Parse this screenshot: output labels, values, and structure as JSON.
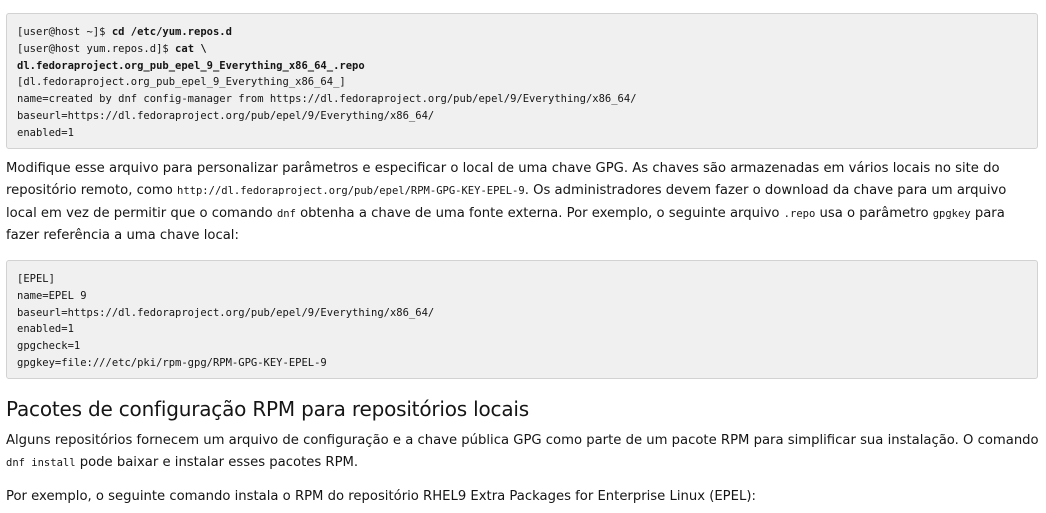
{
  "code_block_1": {
    "lines": [
      {
        "prompt": "[user@host ~]$ ",
        "command": "cd /etc/yum.repos.d"
      },
      {
        "prompt": "[user@host yum.repos.d]$ ",
        "command": "cat \\"
      },
      {
        "prompt": "",
        "command": "dl.fedoraproject.org_pub_epel_9_Everything_x86_64_.repo"
      },
      {
        "output": "[dl.fedoraproject.org_pub_epel_9_Everything_x86_64_]"
      },
      {
        "output": "name=created by dnf config-manager from https://dl.fedoraproject.org/pub/epel/9/Everything/x86_64/"
      },
      {
        "output": "baseurl=https://dl.fedoraproject.org/pub/epel/9/Everything/x86_64/"
      },
      {
        "output": "enabled=1"
      }
    ]
  },
  "paragraph_1": {
    "text_1": "Modifique esse arquivo para personalizar parâmetros e especificar o local de uma chave GPG. As chaves são armazenadas em vários locais no site do repositório remoto, como ",
    "code_1": "http://dl.fedoraproject.org/pub/epel/RPM-GPG-KEY-EPEL-9",
    "text_2": ". Os administradores devem fazer o download da chave para um arquivo local em vez de permitir que o comando ",
    "code_2": "dnf",
    "text_3": " obtenha a chave de uma fonte externa. Por exemplo, o seguinte arquivo ",
    "code_3": ".repo",
    "text_4": " usa o parâmetro ",
    "code_4": "gpgkey",
    "text_5": " para fazer referência a uma chave local:"
  },
  "code_block_2": {
    "lines": [
      "[EPEL]",
      "name=EPEL 9",
      "baseurl=https://dl.fedoraproject.org/pub/epel/9/Everything/x86_64/",
      "enabled=1",
      "gpgcheck=1",
      "gpgkey=file:///etc/pki/rpm-gpg/RPM-GPG-KEY-EPEL-9"
    ]
  },
  "section_heading": "Pacotes de configuração RPM para repositórios locais",
  "paragraph_2": {
    "text_1": "Alguns repositórios fornecem um arquivo de configuração e a chave pública GPG como parte de um pacote RPM para simplificar sua instalação. O comando ",
    "code_1": "dnf install",
    "text_2": " pode baixar e instalar esses pacotes RPM."
  },
  "paragraph_3": {
    "text": "Por exemplo, o seguinte comando instala o RPM do repositório RHEL9 Extra Packages for Enterprise Linux (EPEL):"
  }
}
